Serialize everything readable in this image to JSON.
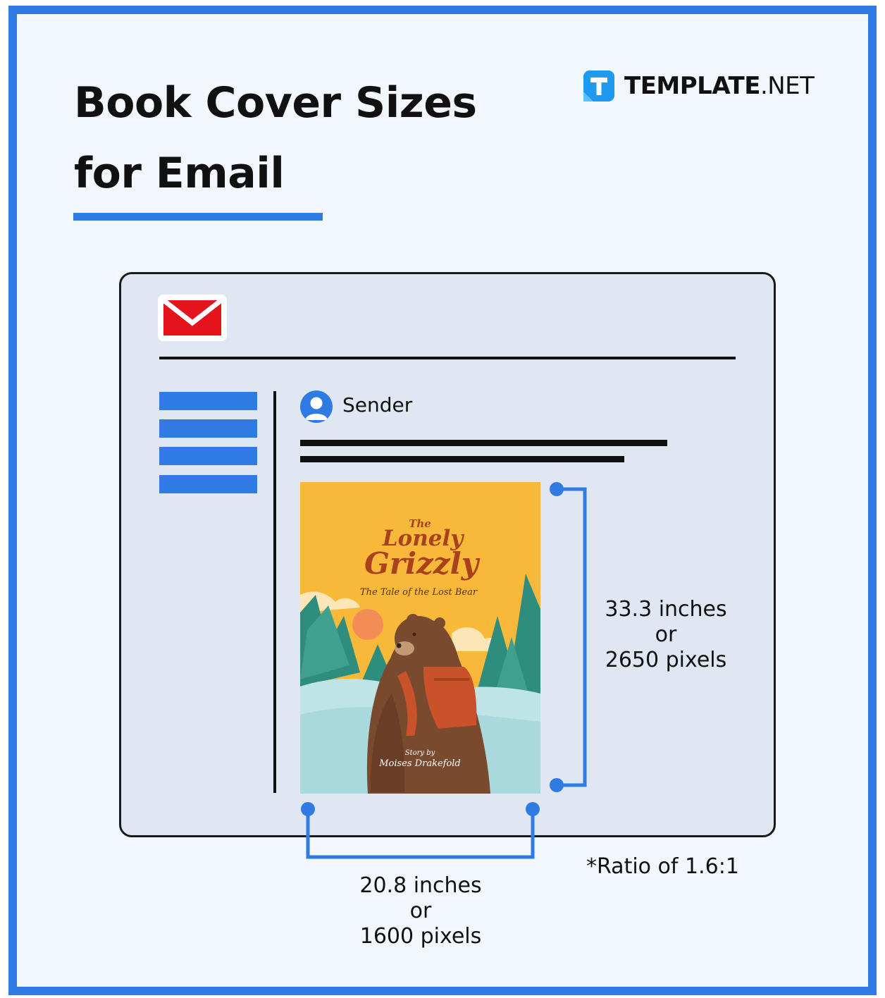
{
  "header": {
    "title_line1": "Book Cover Sizes",
    "title_line2": "for Email",
    "logo": {
      "icon": "t-logo-icon",
      "text_bold": "TEMPLATE",
      "text_light": ".NET"
    }
  },
  "email": {
    "app_icon": "envelope-icon",
    "sender_label": "Sender",
    "avatar_icon": "user-avatar-icon"
  },
  "book_cover": {
    "title_the": "The",
    "title_main1": "Lonely",
    "title_main2": "Grizzly",
    "subtitle": "The Tale of the Lost Bear",
    "byline": "Story by",
    "author": "Moises Drakefold"
  },
  "dimensions": {
    "height_line1": "33.3 inches",
    "height_line2": "or",
    "height_line3": "2650 pixels",
    "width_line1": "20.8 inches",
    "width_line2": "or",
    "width_line3": "1600 pixels",
    "ratio": "*Ratio of 1.6:1"
  },
  "colors": {
    "accent_blue": "#2f7be3",
    "mail_red": "#e3141b",
    "cover_yellow": "#f8b93a",
    "cover_brown": "#a9421c"
  }
}
